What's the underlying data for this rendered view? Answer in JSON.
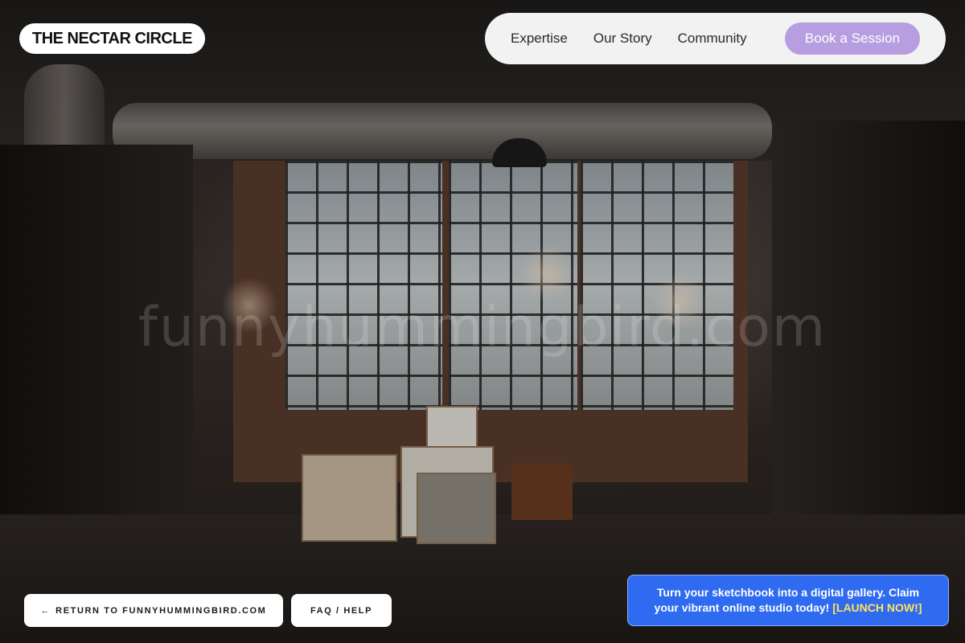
{
  "brand": {
    "name": "THE NECTAR CIRCLE"
  },
  "nav": {
    "links": [
      "Expertise",
      "Our Story",
      "Community"
    ],
    "cta_label": "Book a Session"
  },
  "watermark": "funnyhummingbird.com",
  "bottom": {
    "return_arrow": "←",
    "return_label": "RETURN TO FUNNYHUMMINGBIRD.COM",
    "faq_label": "FAQ / HELP"
  },
  "promo": {
    "text": "Turn your sketchbook into a digital gallery. Claim your vibrant online studio today!",
    "link_label": "[LAUNCH NOW!]"
  },
  "colors": {
    "cta_background": "#b79ee0",
    "promo_background": "#2f6bf0",
    "promo_link": "#ffe45c"
  }
}
